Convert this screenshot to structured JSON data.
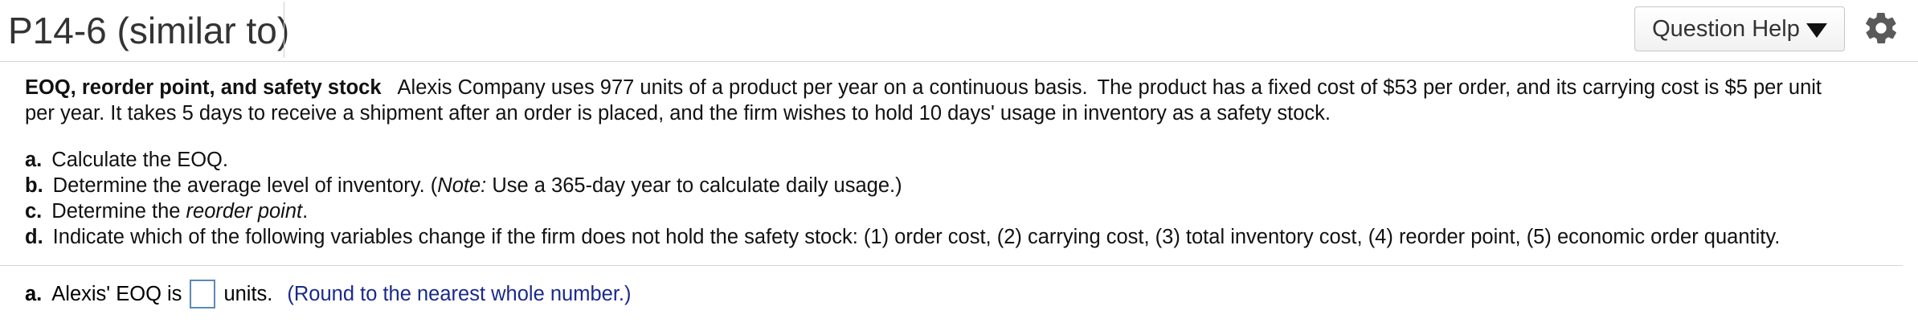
{
  "header": {
    "title": "P14-6 (similar to)",
    "help_label": "Question Help",
    "caret_icon": "caret-down-icon",
    "settings_icon": "gear-icon"
  },
  "problem": {
    "intro_title": "EOQ, reorder point, and safety stock",
    "sentence1": "Alexis Company uses 977 units of a product per year on a continuous basis.",
    "sentence2": "The product has a fixed cost of $53 per order, and its carrying cost is $5 per unit",
    "line2": "per year.  It takes 5 days to receive a shipment after an order is placed, and the firm wishes to hold 10 days' usage in inventory as a safety stock.",
    "parts": [
      {
        "letter": "a.",
        "pre": "Calculate the EOQ.",
        "em": "",
        "post": ""
      },
      {
        "letter": "b.",
        "pre": "Determine the average level of inventory.  (",
        "em": "Note:",
        "post": "  Use a 365-day year to calculate daily usage.)"
      },
      {
        "letter": "c.",
        "pre": "Determine the ",
        "em": "reorder point",
        "post": "."
      },
      {
        "letter": "d.",
        "pre": "Indicate which of the following variables change if the firm does not hold the safety stock: (1) order cost, (2) carrying cost, (3) total inventory cost, (4) reorder point, (5) economic order quantity.",
        "em": "",
        "post": ""
      }
    ]
  },
  "answer": {
    "letter": "a.",
    "pre_text": "Alexis' EOQ is",
    "value": "",
    "post_text": "units.",
    "hint": "(Round to the nearest whole number.)"
  }
}
